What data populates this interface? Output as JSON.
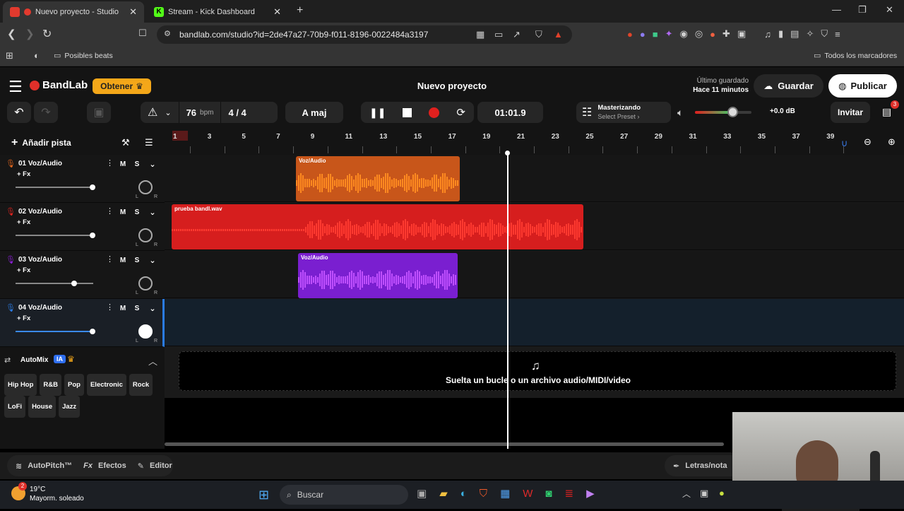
{
  "browser": {
    "tabs": [
      {
        "title": "Nuevo proyecto - Studio",
        "active": true,
        "icon": "bandlab-icon"
      },
      {
        "title": "Stream - Kick Dashboard",
        "active": false,
        "icon": "kick-icon"
      }
    ],
    "url": "bandlab.com/studio?id=2de47a27-70b9-f011-8196-0022484a3197",
    "bookmarks": {
      "folder": "Posibles beats",
      "all": "Todos los marcadores"
    }
  },
  "app": {
    "brand": "BandLab",
    "obtener": "Obtener",
    "project_title": "Nuevo proyecto",
    "last_saved_label": "Último guardado",
    "last_saved_value": "Hace 11 minutos",
    "save": "Guardar",
    "publish": "Publicar",
    "invite": "Invitar",
    "gift_count": "3"
  },
  "toolbar": {
    "bpm": "76",
    "bpm_label": "bpm",
    "time_sig": "4 / 4",
    "key": "A maj",
    "time": "01:01.9",
    "mastering_title": "Masterizando",
    "mastering_preset": "Select Preset",
    "volume_db": "+0.0 dB"
  },
  "add_track": "Añadir pista",
  "ruler": [
    "1",
    "3",
    "5",
    "7",
    "9",
    "11",
    "13",
    "15",
    "17",
    "19",
    "21",
    "23",
    "25",
    "27",
    "29",
    "31",
    "33",
    "35",
    "37",
    "39"
  ],
  "tracks": [
    {
      "name": "01  Voz/Audio",
      "fx": "+ Fx",
      "color": "#e0641b",
      "vol": 0.85
    },
    {
      "name": "02  Voz/Audio",
      "fx": "+ Fx",
      "color": "#e0231f",
      "vol": 0.85
    },
    {
      "name": "03  Voz/Audio",
      "fx": "+ Fx",
      "color": "#8b1fd6",
      "vol": 0.65
    },
    {
      "name": "04  Voz/Audio",
      "fx": "+ Fx",
      "color": "#2a7be4",
      "vol": 0.85
    }
  ],
  "clips": [
    {
      "label": "Voz/Audio",
      "color": "#c8561a"
    },
    {
      "label": "prueba bandl.wav",
      "color": "#d61e1e"
    },
    {
      "label": "Voz/Audio",
      "color": "#7a1fd0"
    }
  ],
  "automix": {
    "title": "AutoMix",
    "badge": "IA",
    "genres": [
      "Hip Hop",
      "R&B",
      "Pop",
      "Electronic",
      "Rock",
      "LoFi",
      "House",
      "Jazz"
    ]
  },
  "dropzone": "Suelta un bucle o un archivo audio/MIDI/video",
  "footer": {
    "autopitch": "AutoPitch™",
    "effects": "Efectos",
    "editor": "Editor",
    "lyrics": "Letras/nota"
  },
  "taskbar": {
    "temp": "19°C",
    "weather": "Mayorm. soleado",
    "search": "Buscar",
    "badge": "2"
  }
}
